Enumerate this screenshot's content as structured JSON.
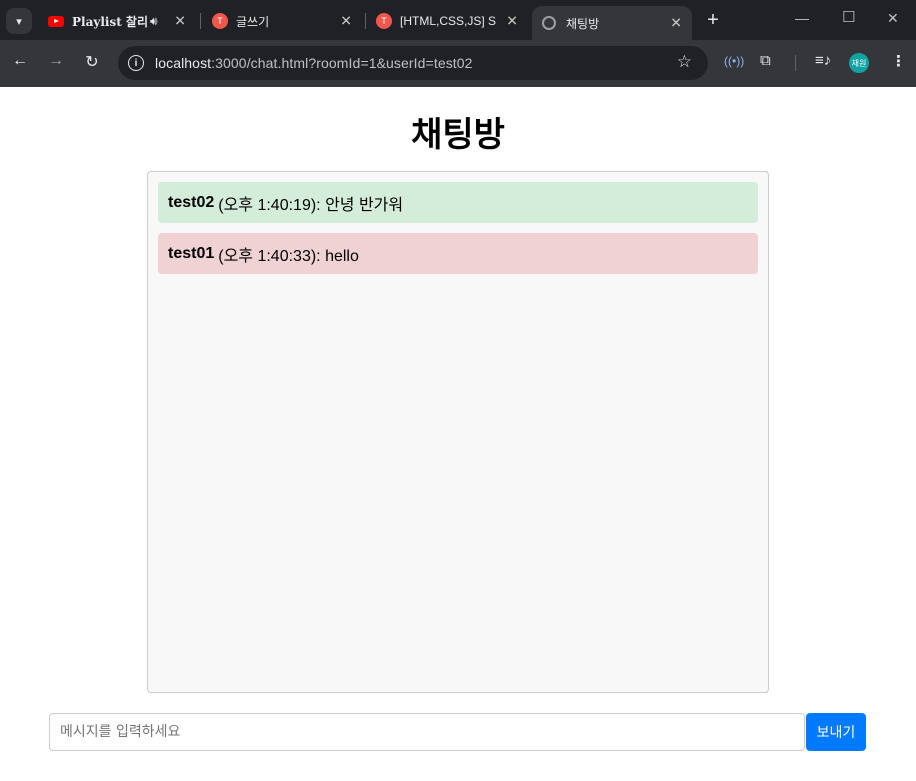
{
  "browser": {
    "tabs": [
      {
        "title": "Playlist 찰리",
        "favicon": "youtube-icon",
        "audio": true,
        "active": false
      },
      {
        "title": "글쓰기",
        "favicon": "t-logo-icon",
        "active": false
      },
      {
        "title": "[HTML,CSS,JS] So",
        "favicon": "t-logo-icon",
        "active": false
      },
      {
        "title": "채팅방",
        "favicon": "globe-icon",
        "active": true
      }
    ],
    "address": {
      "host": "localhost",
      "path": ":3000/chat.html?roomId=1&userId=test02"
    },
    "profile_label": "채원"
  },
  "page": {
    "title": "채팅방",
    "messages": [
      {
        "user": "test02",
        "meta": "(오후 1:40:19): 안녕 반가워",
        "type": "me"
      },
      {
        "user": "test01",
        "meta": "(오후 1:40:33): hello",
        "type": "other"
      }
    ],
    "input": {
      "placeholder": "메시지를 입력하세요",
      "value": ""
    },
    "send_label": "보내기"
  },
  "colors": {
    "my_message_bg": "#d4edda",
    "other_message_bg": "#f1d2d4",
    "send_button": "#007bff"
  }
}
